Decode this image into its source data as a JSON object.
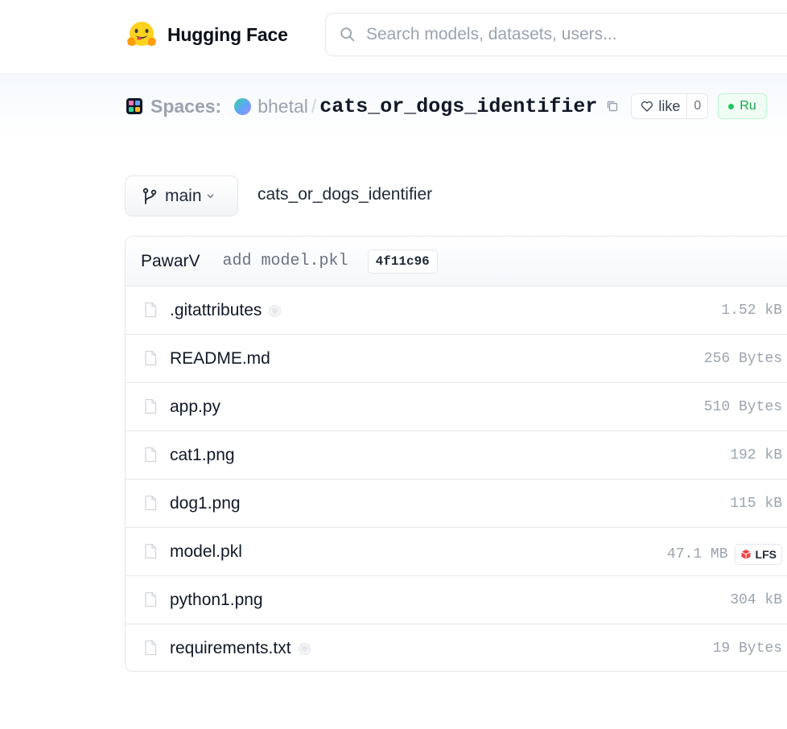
{
  "header": {
    "brand": "Hugging Face",
    "search_placeholder": "Search models, datasets, users..."
  },
  "repo": {
    "section_label": "Spaces:",
    "owner": "bhetal",
    "separator": "/",
    "name": "cats_or_dogs_identifier",
    "like_label": "like",
    "like_count": "0",
    "status": "Running",
    "status_visible": "Ru"
  },
  "branch": {
    "label": "main",
    "path": "cats_or_dogs_identifier"
  },
  "commit": {
    "author": "PawarV",
    "message": "add model.pkl",
    "hash": "4f11c96"
  },
  "files": [
    {
      "name": ".gitattributes",
      "size": "1.52 kB",
      "safe_icon": true,
      "lfs": false
    },
    {
      "name": "README.md",
      "size": "256 Bytes",
      "safe_icon": false,
      "lfs": false
    },
    {
      "name": "app.py",
      "size": "510 Bytes",
      "safe_icon": false,
      "lfs": false
    },
    {
      "name": "cat1.png",
      "size": "192 kB",
      "safe_icon": false,
      "lfs": false
    },
    {
      "name": "dog1.png",
      "size": "115 kB",
      "safe_icon": false,
      "lfs": false
    },
    {
      "name": "model.pkl",
      "size": "47.1 MB",
      "safe_icon": false,
      "lfs": true,
      "lfs_label": "LFS"
    },
    {
      "name": "python1.png",
      "size": "304 kB",
      "safe_icon": false,
      "lfs": false
    },
    {
      "name": "requirements.txt",
      "size": "19 Bytes",
      "safe_icon": true,
      "lfs": false
    }
  ],
  "icons": {
    "logo": "hugging-face-logo",
    "search": "search-icon",
    "spaces": "spaces-icon",
    "copy": "copy-icon",
    "like": "heart-icon",
    "branch": "git-branch-icon",
    "file": "file-icon",
    "safe": "shield-check-icon",
    "lfs": "lfs-icon"
  },
  "colors": {
    "brand_yellow": "#FFD21E",
    "status_green": "#16a34a",
    "lfs_red": "#ef4444"
  }
}
